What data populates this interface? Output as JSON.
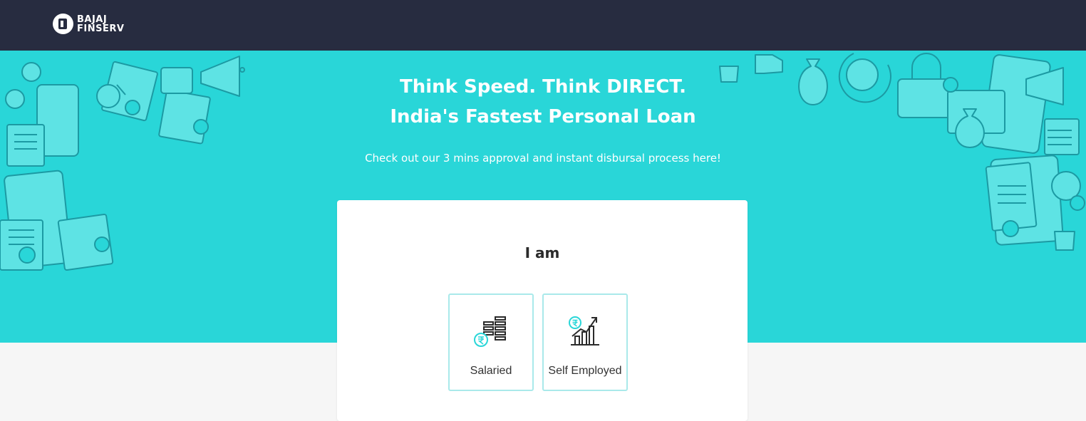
{
  "header": {
    "brand_line1": "BAJAJ",
    "brand_line2": "FINSERV",
    "logo_icon": "bajaj-finserv-logo"
  },
  "hero": {
    "title_line1": "Think Speed. Think DIRECT.",
    "title_line2": "India's Fastest Personal Loan",
    "subtitle": "Check out our 3 mins approval and instant disbursal process here!",
    "background_color": "#29d6d8",
    "illustration_icons": [
      "facebook-icon",
      "linkedin-icon",
      "smartphone-icon",
      "document-icon",
      "magnifier-icon",
      "megaphone-icon",
      "wallet-icon",
      "gear-icon",
      "thumbs-up-icon",
      "coffee-cup-icon",
      "money-bag-icon",
      "alarm-clock-icon",
      "padlock-icon",
      "checkmark-icon"
    ]
  },
  "selection_card": {
    "heading": "I am",
    "options": [
      {
        "label": "Salaried",
        "icon": "salary-coins-icon"
      },
      {
        "label": "Self Employed",
        "icon": "growth-chart-icon"
      }
    ]
  },
  "colors": {
    "navbar": "#272c40",
    "accent": "#29d6d8",
    "option_border": "#a9e9ea"
  }
}
